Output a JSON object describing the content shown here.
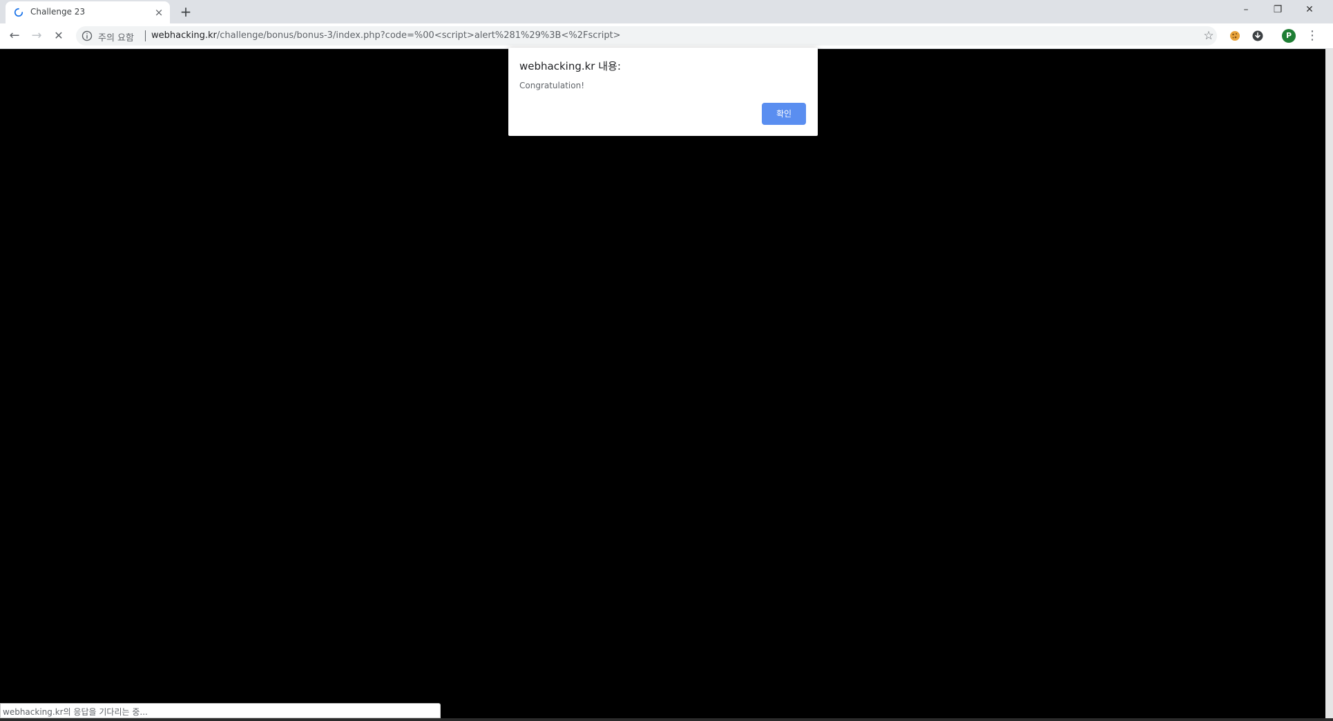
{
  "window": {
    "minimize_label": "–",
    "restore_label": "❐",
    "close_label": "✕"
  },
  "tab": {
    "title": "Challenge 23",
    "close_label": "×",
    "loading": true
  },
  "new_tab_label": "+",
  "toolbar": {
    "back_label": "←",
    "forward_label": "→",
    "stop_label": "✕",
    "security_label": "주의 요함",
    "url_host": "webhacking.kr",
    "url_path": "/challenge/bonus/bonus-3/index.php?code=%00<script>alert%281%29%3B<%2Fscript>",
    "star_label": "☆",
    "profile_initial": "P",
    "menu_label": "⋮"
  },
  "icons": {
    "info": "info-icon",
    "bookmark": "star-icon",
    "cookie_ext": "cookie-extension-icon",
    "download_ext": "download-extension-icon"
  },
  "alert": {
    "title": "webhacking.kr 내용:",
    "message": "Congratulation!",
    "ok_label": "확인"
  },
  "status": {
    "text": "webhacking.kr의 응답을 기다리는 중..."
  },
  "colors": {
    "page_background": "#000000",
    "tabstrip": "#dee1e6",
    "ok_button": "#5a8ef0",
    "spinner": "#1a73e8",
    "profile": "#1e7e34"
  }
}
